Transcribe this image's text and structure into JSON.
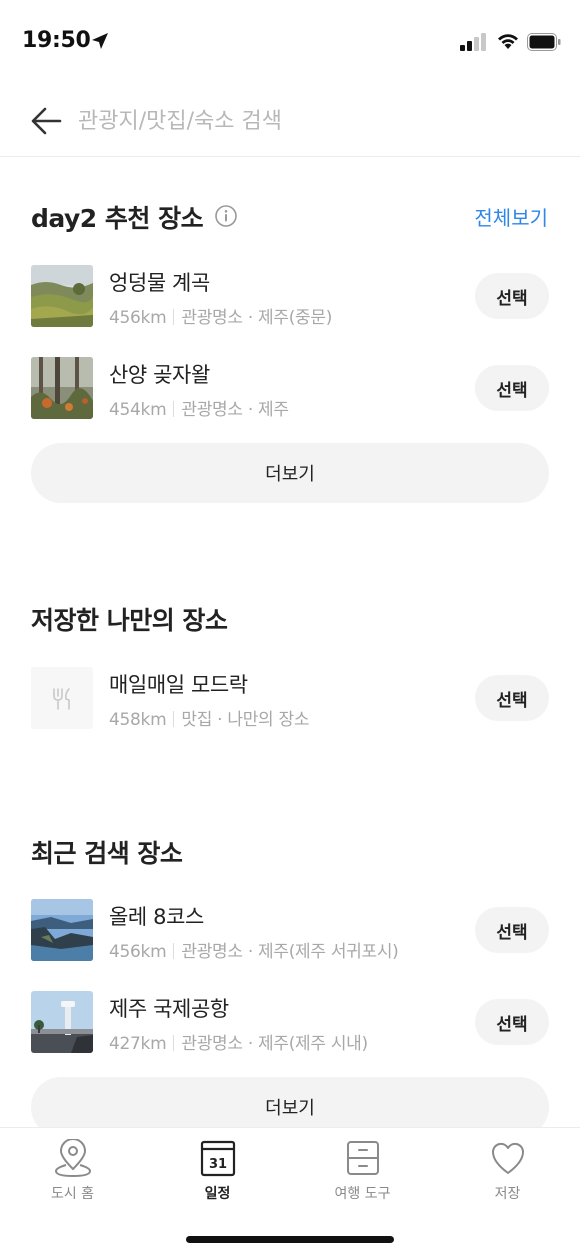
{
  "status_bar": {
    "time": "19:50"
  },
  "search": {
    "placeholder": "관광지/맛집/숙소 검색"
  },
  "recommended": {
    "title": "day2 추천 장소",
    "see_all_label": "전체보기",
    "items": [
      {
        "name": "엉덩물 계곡",
        "distance": "456km",
        "info": "관광명소 · 제주(중문)",
        "select_label": "선택",
        "thumb": "terraced-valley-photo"
      },
      {
        "name": "산양 곶자왈",
        "distance": "454km",
        "info": "관광명소 · 제주",
        "select_label": "선택",
        "thumb": "forest-photo"
      }
    ],
    "more_label": "더보기"
  },
  "saved": {
    "title": "저장한 나만의 장소",
    "items": [
      {
        "name": "매일매일 모드락",
        "distance": "458km",
        "info": "맛집 · 나만의 장소",
        "select_label": "선택",
        "thumb": "restaurant-icon"
      }
    ]
  },
  "recent": {
    "title": "최근 검색 장소",
    "items": [
      {
        "name": "올레 8코스",
        "distance": "456km",
        "info": "관광명소 · 제주(제주 서귀포시)",
        "select_label": "선택",
        "thumb": "coast-cliff-photo"
      },
      {
        "name": "제주 국제공항",
        "distance": "427km",
        "info": "관광명소 · 제주(제주 시내)",
        "select_label": "선택",
        "thumb": "airport-tower-photo"
      }
    ],
    "more_label": "더보기"
  },
  "tab_bar": {
    "tabs": [
      {
        "label": "도시 홈",
        "icon": "location-pin-icon",
        "active": false
      },
      {
        "label": "일정",
        "icon": "calendar-icon",
        "active": true,
        "calendar_day": "31"
      },
      {
        "label": "여행 도구",
        "icon": "toolbox-icon",
        "active": false
      },
      {
        "label": "저장",
        "icon": "heart-icon",
        "active": false
      }
    ]
  },
  "colors": {
    "accent": "#2f87e8",
    "button_bg": "#f3f3f3",
    "meta_text": "#a8a8a8",
    "placeholder": "#b8b8b8"
  }
}
